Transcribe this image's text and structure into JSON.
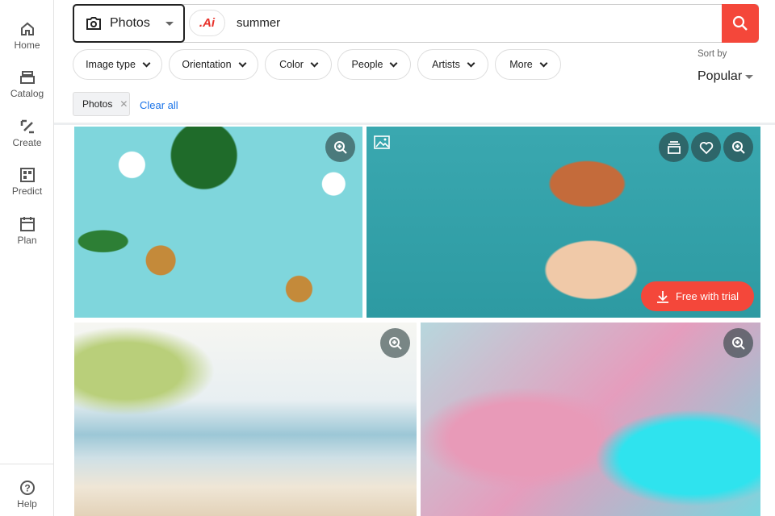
{
  "sidebar": {
    "items": [
      {
        "label": "Home",
        "icon": "home-icon"
      },
      {
        "label": "Catalog",
        "icon": "catalog-icon"
      },
      {
        "label": "Create",
        "icon": "create-icon"
      },
      {
        "label": "Predict",
        "icon": "predict-icon"
      },
      {
        "label": "Plan",
        "icon": "plan-icon"
      }
    ],
    "help": "Help"
  },
  "search": {
    "type": "Photos",
    "ai_label": ".Ai",
    "query": "summer"
  },
  "filters": [
    "Image type",
    "Orientation",
    "Color",
    "People",
    "Artists",
    "More"
  ],
  "sort": {
    "label": "Sort by",
    "value": "Popular"
  },
  "active_filters": {
    "tag": "Photos",
    "clear": "Clear all"
  },
  "results": {
    "cta": "Free with trial"
  },
  "colors": {
    "accent": "#f4473a",
    "link": "#1a73e8"
  }
}
